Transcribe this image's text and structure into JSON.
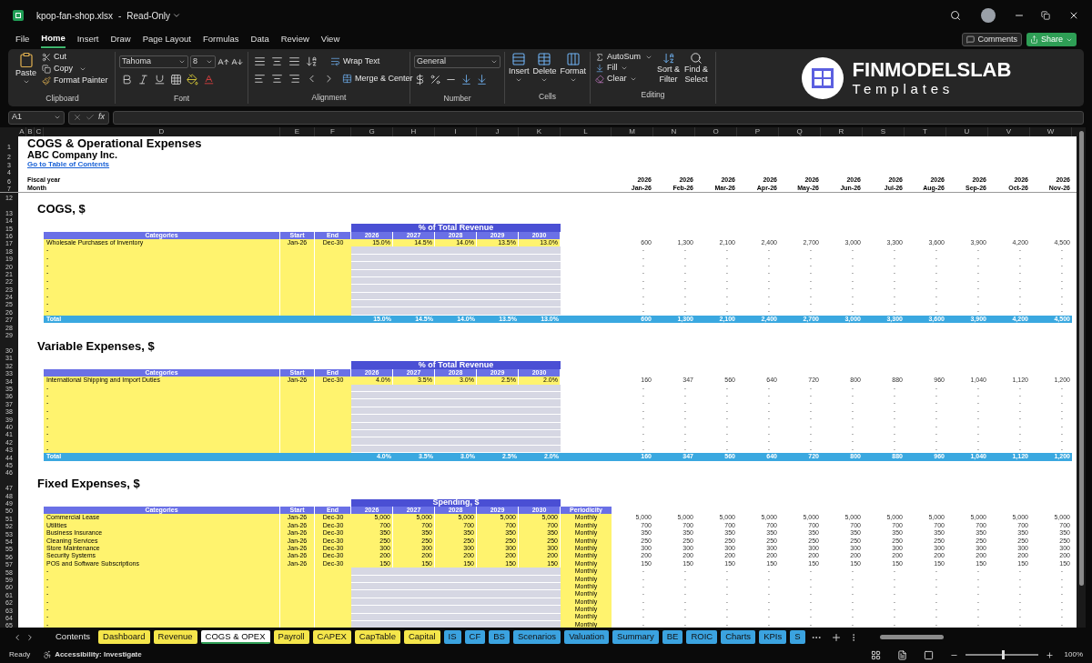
{
  "window": {
    "file_name": "kpop-fan-shop.xlsx",
    "separator": "-",
    "mode": "Read-Only"
  },
  "menu_tabs": [
    {
      "label": "File",
      "selected": false
    },
    {
      "label": "Home",
      "selected": true
    },
    {
      "label": "Insert",
      "selected": false
    },
    {
      "label": "Draw",
      "selected": false
    },
    {
      "label": "Page Layout",
      "selected": false
    },
    {
      "label": "Formulas",
      "selected": false
    },
    {
      "label": "Data",
      "selected": false
    },
    {
      "label": "Review",
      "selected": false
    },
    {
      "label": "View",
      "selected": false
    }
  ],
  "actions": {
    "comments": "Comments",
    "share": "Share"
  },
  "ribbon": {
    "clipboard": {
      "paste": "Paste",
      "cut": "Cut",
      "copy": "Copy",
      "format_painter": "Format Painter",
      "label": "Clipboard"
    },
    "font": {
      "family": "Tahoma",
      "size": "8",
      "label": "Font"
    },
    "alignment": {
      "wrap": "Wrap Text",
      "merge": "Merge & Center",
      "label": "Alignment"
    },
    "number": {
      "format": "General",
      "label": "Number"
    },
    "cells": {
      "insert": "Insert",
      "delete": "Delete",
      "format": "Format",
      "label": "Cells"
    },
    "editing": {
      "autosum": "AutoSum",
      "fill": "Fill",
      "clear": "Clear",
      "sort_1": "Sort &",
      "sort_2": "Filter",
      "find_1": "Find &",
      "find_2": "Select",
      "label": "Editing"
    }
  },
  "logo": {
    "name": "FINMODELSLAB",
    "tagline": "Templates"
  },
  "formula_bar": {
    "cell": "A1",
    "fx": "fx"
  },
  "columns": [
    "A",
    "B",
    "C",
    "D",
    "E",
    "F",
    "G",
    "H",
    "I",
    "J",
    "K",
    "L",
    "M",
    "N",
    "O",
    "P",
    "Q",
    "R",
    "S",
    "T",
    "U",
    "V",
    "W"
  ],
  "rows": [
    {
      "n": "1",
      "kind": "title",
      "text": "COGS & Operational Expenses"
    },
    {
      "n": "2",
      "kind": "company",
      "text": "ABC Company Inc."
    },
    {
      "n": "3",
      "kind": "link",
      "text": "Go to Table of Contents"
    },
    {
      "n": "4",
      "kind": "blank"
    },
    {
      "n": "6",
      "kind": "timeline",
      "label": "Fiscal year",
      "cells": [
        "2026",
        "2026",
        "2026",
        "2026",
        "2026",
        "2026",
        "2026",
        "2026",
        "2026",
        "2026",
        "2026"
      ]
    },
    {
      "n": "7",
      "kind": "timeline",
      "label": "Month",
      "cells": [
        "Jan-26",
        "Feb-26",
        "Mar-26",
        "Apr-26",
        "May-26",
        "Jun-26",
        "Jul-26",
        "Aug-26",
        "Sep-26",
        "Oct-26",
        "Nov-26"
      ]
    },
    {
      "n": "12",
      "kind": "blank"
    },
    {
      "n": "13",
      "kind": "section",
      "text": "COGS, $"
    },
    {
      "n": "14",
      "kind": "blank"
    },
    {
      "n": "15",
      "kind": "band",
      "text": "% of Total Revenue"
    },
    {
      "n": "16",
      "kind": "header",
      "cells": [
        "Categories",
        "Start",
        "End",
        "2026",
        "2027",
        "2028",
        "2029",
        "2030"
      ]
    },
    {
      "n": "17",
      "kind": "item",
      "category": "Wholesale Purchases of Inventory",
      "start": "Jan-26",
      "end": "Dec-30",
      "years": [
        "15.0%",
        "14.5%",
        "14.0%",
        "13.5%",
        "13.0%"
      ],
      "months": [
        "600",
        "1,300",
        "2,100",
        "2,400",
        "2,700",
        "3,000",
        "3,300",
        "3,600",
        "3,900",
        "4,200",
        "4,500"
      ]
    },
    {
      "n": "18",
      "kind": "empty",
      "category": "-",
      "months": [
        "-",
        "-",
        "-",
        "-",
        "-",
        "-",
        "-",
        "-",
        "-",
        "-",
        "-"
      ]
    },
    {
      "n": "19",
      "kind": "empty",
      "category": "-",
      "months": [
        "-",
        "-",
        "-",
        "-",
        "-",
        "-",
        "-",
        "-",
        "-",
        "-",
        "-"
      ]
    },
    {
      "n": "20",
      "kind": "empty",
      "category": "-",
      "months": [
        "-",
        "-",
        "-",
        "-",
        "-",
        "-",
        "-",
        "-",
        "-",
        "-",
        "-"
      ]
    },
    {
      "n": "21",
      "kind": "empty",
      "category": "-",
      "months": [
        "-",
        "-",
        "-",
        "-",
        "-",
        "-",
        "-",
        "-",
        "-",
        "-",
        "-"
      ]
    },
    {
      "n": "22",
      "kind": "empty",
      "category": "-",
      "months": [
        "-",
        "-",
        "-",
        "-",
        "-",
        "-",
        "-",
        "-",
        "-",
        "-",
        "-"
      ]
    },
    {
      "n": "23",
      "kind": "empty",
      "category": "-",
      "months": [
        "-",
        "-",
        "-",
        "-",
        "-",
        "-",
        "-",
        "-",
        "-",
        "-",
        "-"
      ]
    },
    {
      "n": "24",
      "kind": "empty",
      "category": "-",
      "months": [
        "-",
        "-",
        "-",
        "-",
        "-",
        "-",
        "-",
        "-",
        "-",
        "-",
        "-"
      ]
    },
    {
      "n": "25",
      "kind": "empty",
      "category": "-",
      "months": [
        "-",
        "-",
        "-",
        "-",
        "-",
        "-",
        "-",
        "-",
        "-",
        "-",
        "-"
      ]
    },
    {
      "n": "26",
      "kind": "empty",
      "category": "-",
      "months": [
        "-",
        "-",
        "-",
        "-",
        "-",
        "-",
        "-",
        "-",
        "-",
        "-",
        "-"
      ]
    },
    {
      "n": "27",
      "kind": "total",
      "label": "Total",
      "years": [
        "15.0%",
        "14.5%",
        "14.0%",
        "13.5%",
        "13.0%"
      ],
      "months": [
        "600",
        "1,300",
        "2,100",
        "2,400",
        "2,700",
        "3,000",
        "3,300",
        "3,600",
        "3,900",
        "4,200",
        "4,500"
      ]
    },
    {
      "n": "28",
      "kind": "blank"
    },
    {
      "n": "29",
      "kind": "blank"
    },
    {
      "n": "30",
      "kind": "section",
      "text": "Variable Expenses, $"
    },
    {
      "n": "31",
      "kind": "blank"
    },
    {
      "n": "32",
      "kind": "band",
      "text": "% of Total Revenue"
    },
    {
      "n": "33",
      "kind": "header",
      "cells": [
        "Categories",
        "Start",
        "End",
        "2026",
        "2027",
        "2028",
        "2029",
        "2030"
      ]
    },
    {
      "n": "34",
      "kind": "item",
      "category": "International Shipping and Import Duties",
      "start": "Jan-26",
      "end": "Dec-30",
      "years": [
        "4.0%",
        "3.5%",
        "3.0%",
        "2.5%",
        "2.0%"
      ],
      "months": [
        "160",
        "347",
        "560",
        "640",
        "720",
        "800",
        "880",
        "960",
        "1,040",
        "1,120",
        "1,200"
      ]
    },
    {
      "n": "35",
      "kind": "empty",
      "category": "-",
      "months": [
        "-",
        "-",
        "-",
        "-",
        "-",
        "-",
        "-",
        "-",
        "-",
        "-",
        "-"
      ]
    },
    {
      "n": "36",
      "kind": "empty",
      "category": "-",
      "months": [
        "-",
        "-",
        "-",
        "-",
        "-",
        "-",
        "-",
        "-",
        "-",
        "-",
        "-"
      ]
    },
    {
      "n": "37",
      "kind": "empty",
      "category": "-",
      "months": [
        "-",
        "-",
        "-",
        "-",
        "-",
        "-",
        "-",
        "-",
        "-",
        "-",
        "-"
      ]
    },
    {
      "n": "38",
      "kind": "empty",
      "category": "-",
      "months": [
        "-",
        "-",
        "-",
        "-",
        "-",
        "-",
        "-",
        "-",
        "-",
        "-",
        "-"
      ]
    },
    {
      "n": "39",
      "kind": "empty",
      "category": "-",
      "months": [
        "-",
        "-",
        "-",
        "-",
        "-",
        "-",
        "-",
        "-",
        "-",
        "-",
        "-"
      ]
    },
    {
      "n": "40",
      "kind": "empty",
      "category": "-",
      "months": [
        "-",
        "-",
        "-",
        "-",
        "-",
        "-",
        "-",
        "-",
        "-",
        "-",
        "-"
      ]
    },
    {
      "n": "41",
      "kind": "empty",
      "category": "-",
      "months": [
        "-",
        "-",
        "-",
        "-",
        "-",
        "-",
        "-",
        "-",
        "-",
        "-",
        "-"
      ]
    },
    {
      "n": "42",
      "kind": "empty",
      "category": "-",
      "months": [
        "-",
        "-",
        "-",
        "-",
        "-",
        "-",
        "-",
        "-",
        "-",
        "-",
        "-"
      ]
    },
    {
      "n": "43",
      "kind": "empty",
      "category": "-",
      "months": [
        "-",
        "-",
        "-",
        "-",
        "-",
        "-",
        "-",
        "-",
        "-",
        "-",
        "-"
      ]
    },
    {
      "n": "44",
      "kind": "total",
      "label": "Total",
      "years": [
        "4.0%",
        "3.5%",
        "3.0%",
        "2.5%",
        "2.0%"
      ],
      "months": [
        "160",
        "347",
        "560",
        "640",
        "720",
        "800",
        "880",
        "960",
        "1,040",
        "1,120",
        "1,200"
      ]
    },
    {
      "n": "45",
      "kind": "blank"
    },
    {
      "n": "46",
      "kind": "blank"
    },
    {
      "n": "47",
      "kind": "section",
      "text": "Fixed Expenses, $"
    },
    {
      "n": "48",
      "kind": "blank"
    },
    {
      "n": "49",
      "kind": "band",
      "text": "Spending, $"
    },
    {
      "n": "50",
      "kind": "header",
      "cells": [
        "Categories",
        "Start",
        "End",
        "2026",
        "2027",
        "2028",
        "2029",
        "2030"
      ],
      "periodicity": "Periodicity"
    },
    {
      "n": "51",
      "kind": "item",
      "category": "Commercial Lease",
      "start": "Jan-26",
      "end": "Dec-30",
      "years": [
        "5,000",
        "5,000",
        "5,000",
        "5,000",
        "5,000"
      ],
      "periodicity": "Monthly",
      "months": [
        "5,000",
        "5,000",
        "5,000",
        "5,000",
        "5,000",
        "5,000",
        "5,000",
        "5,000",
        "5,000",
        "5,000",
        "5,000"
      ]
    },
    {
      "n": "52",
      "kind": "item",
      "category": "Utilities",
      "start": "Jan-26",
      "end": "Dec-30",
      "years": [
        "700",
        "700",
        "700",
        "700",
        "700"
      ],
      "periodicity": "Monthly",
      "months": [
        "700",
        "700",
        "700",
        "700",
        "700",
        "700",
        "700",
        "700",
        "700",
        "700",
        "700"
      ]
    },
    {
      "n": "53",
      "kind": "item",
      "category": "Business Insurance",
      "start": "Jan-26",
      "end": "Dec-30",
      "years": [
        "350",
        "350",
        "350",
        "350",
        "350"
      ],
      "periodicity": "Monthly",
      "months": [
        "350",
        "350",
        "350",
        "350",
        "350",
        "350",
        "350",
        "350",
        "350",
        "350",
        "350"
      ]
    },
    {
      "n": "54",
      "kind": "item",
      "category": "Cleaning Services",
      "start": "Jan-26",
      "end": "Dec-30",
      "years": [
        "250",
        "250",
        "250",
        "250",
        "250"
      ],
      "periodicity": "Monthly",
      "months": [
        "250",
        "250",
        "250",
        "250",
        "250",
        "250",
        "250",
        "250",
        "250",
        "250",
        "250"
      ]
    },
    {
      "n": "55",
      "kind": "item",
      "category": "Store Maintenance",
      "start": "Jan-26",
      "end": "Dec-30",
      "years": [
        "300",
        "300",
        "300",
        "300",
        "300"
      ],
      "periodicity": "Monthly",
      "months": [
        "300",
        "300",
        "300",
        "300",
        "300",
        "300",
        "300",
        "300",
        "300",
        "300",
        "300"
      ]
    },
    {
      "n": "56",
      "kind": "item",
      "category": "Security Systems",
      "start": "Jan-26",
      "end": "Dec-30",
      "years": [
        "200",
        "200",
        "200",
        "200",
        "200"
      ],
      "periodicity": "Monthly",
      "months": [
        "200",
        "200",
        "200",
        "200",
        "200",
        "200",
        "200",
        "200",
        "200",
        "200",
        "200"
      ]
    },
    {
      "n": "57",
      "kind": "item",
      "category": "POS and Software Subscriptions",
      "start": "Jan-26",
      "end": "Dec-30",
      "years": [
        "150",
        "150",
        "150",
        "150",
        "150"
      ],
      "periodicity": "Monthly",
      "months": [
        "150",
        "150",
        "150",
        "150",
        "150",
        "150",
        "150",
        "150",
        "150",
        "150",
        "150"
      ]
    },
    {
      "n": "58",
      "kind": "empty",
      "category": "-",
      "periodicity": "Monthly",
      "months": [
        "-",
        "-",
        "-",
        "-",
        "-",
        "-",
        "-",
        "-",
        "-",
        "-",
        "-"
      ]
    },
    {
      "n": "59",
      "kind": "empty",
      "category": "-",
      "periodicity": "Monthly",
      "months": [
        "-",
        "-",
        "-",
        "-",
        "-",
        "-",
        "-",
        "-",
        "-",
        "-",
        "-"
      ]
    },
    {
      "n": "60",
      "kind": "empty",
      "category": "-",
      "periodicity": "Monthly",
      "months": [
        "-",
        "-",
        "-",
        "-",
        "-",
        "-",
        "-",
        "-",
        "-",
        "-",
        "-"
      ]
    },
    {
      "n": "61",
      "kind": "empty",
      "category": "-",
      "periodicity": "Monthly",
      "months": [
        "-",
        "-",
        "-",
        "-",
        "-",
        "-",
        "-",
        "-",
        "-",
        "-",
        "-"
      ]
    },
    {
      "n": "62",
      "kind": "empty",
      "category": "-",
      "periodicity": "Monthly",
      "months": [
        "-",
        "-",
        "-",
        "-",
        "-",
        "-",
        "-",
        "-",
        "-",
        "-",
        "-"
      ]
    },
    {
      "n": "63",
      "kind": "empty",
      "category": "-",
      "periodicity": "Monthly",
      "months": [
        "-",
        "-",
        "-",
        "-",
        "-",
        "-",
        "-",
        "-",
        "-",
        "-",
        "-"
      ]
    },
    {
      "n": "64",
      "kind": "empty",
      "category": "-",
      "periodicity": "Monthly",
      "months": [
        "-",
        "-",
        "-",
        "-",
        "-",
        "-",
        "-",
        "-",
        "-",
        "-",
        "-"
      ]
    },
    {
      "n": "65",
      "kind": "empty",
      "category": "-",
      "periodicity": "Monthly",
      "months": [
        "-",
        "-",
        "-",
        "-",
        "-",
        "-",
        "-",
        "-",
        "-",
        "-",
        "-"
      ]
    }
  ],
  "sheet_tabs": [
    {
      "label": "Contents",
      "selected": false
    },
    {
      "label": "Dashboard",
      "selected": false,
      "color": "#f5e64b"
    },
    {
      "label": "Revenue",
      "selected": false,
      "color": "#f5e64b"
    },
    {
      "label": "COGS & OPEX",
      "selected": true
    },
    {
      "label": "Payroll",
      "selected": false,
      "color": "#f5e64b"
    },
    {
      "label": "CAPEX",
      "selected": false,
      "color": "#f5e64b"
    },
    {
      "label": "CapTable",
      "selected": false,
      "color": "#f5e64b"
    },
    {
      "label": "Capital",
      "selected": false,
      "color": "#f5e64b"
    },
    {
      "label": "IS",
      "selected": false,
      "color": "#3ba3e0"
    },
    {
      "label": "CF",
      "selected": false,
      "color": "#3ba3e0"
    },
    {
      "label": "BS",
      "selected": false,
      "color": "#3ba3e0"
    },
    {
      "label": "Scenarios",
      "selected": false,
      "color": "#3ba3e0"
    },
    {
      "label": "Valuation",
      "selected": false,
      "color": "#3ba3e0"
    },
    {
      "label": "Summary",
      "selected": false,
      "color": "#3ba3e0"
    },
    {
      "label": "BE",
      "selected": false,
      "color": "#3ba3e0"
    },
    {
      "label": "ROIC",
      "selected": false,
      "color": "#3ba3e0"
    },
    {
      "label": "Charts",
      "selected": false,
      "color": "#3ba3e0"
    },
    {
      "label": "KPIs",
      "selected": false,
      "color": "#3ba3e0"
    },
    {
      "label": "S",
      "selected": false,
      "color": "#3ba3e0"
    }
  ],
  "status_bar": {
    "state": "Ready",
    "accessibility": "Accessibility: Investigate",
    "zoom": "100%",
    "zoom_slider": {
      "level": 0.5
    }
  }
}
